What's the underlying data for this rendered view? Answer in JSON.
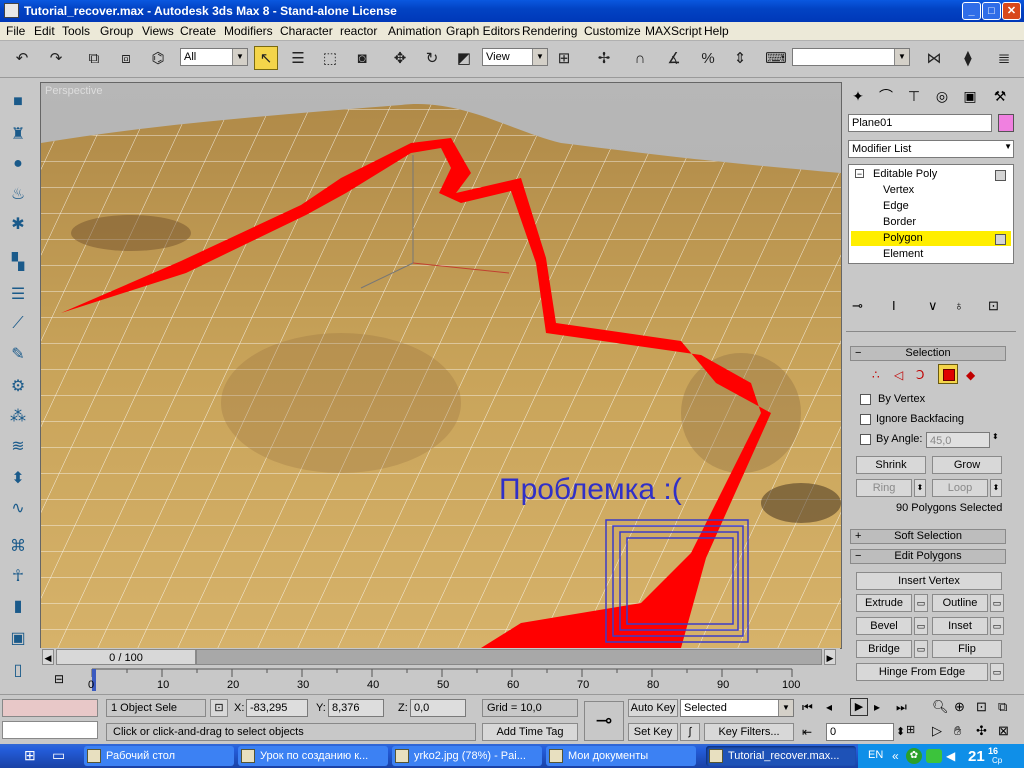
{
  "window": {
    "title": "Tutorial_recover.max - Autodesk 3ds Max 8 - Stand-alone License",
    "minimize_glyph": "_",
    "maximize_glyph": "□",
    "close_glyph": "✕"
  },
  "menu": [
    "File",
    "Edit",
    "Tools",
    "Group",
    "Views",
    "Create",
    "Modifiers",
    "Character",
    "reactor",
    "Animation",
    "Graph Editors",
    "Rendering",
    "Customize",
    "MAXScript",
    "Help"
  ],
  "toolbar": {
    "selection_filter": "All",
    "ref_coord": "View",
    "named_selection": ""
  },
  "viewport": {
    "label": "Perspective",
    "overlay_text": "Проблемка :("
  },
  "command_panel": {
    "object_name": "Plane01",
    "object_color": "#f080e0",
    "modifier_list": "Modifier List",
    "stack": {
      "base": "Editable Poly",
      "subs": [
        "Vertex",
        "Edge",
        "Border",
        "Polygon",
        "Element"
      ],
      "selected": "Polygon"
    },
    "selection": {
      "header": "Selection",
      "by_vertex": "By Vertex",
      "ignore_backfacing": "Ignore Backfacing",
      "by_angle": "By Angle:",
      "angle_value": "45,0",
      "shrink": "Shrink",
      "grow": "Grow",
      "ring": "Ring",
      "loop": "Loop",
      "status": "90 Polygons Selected"
    },
    "soft_selection": "Soft Selection",
    "edit_polygons": {
      "header": "Edit Polygons",
      "insert_vertex": "Insert Vertex",
      "extrude": "Extrude",
      "outline": "Outline",
      "bevel": "Bevel",
      "inset": "Inset",
      "bridge": "Bridge",
      "flip": "Flip",
      "hinge": "Hinge From Edge"
    }
  },
  "timeline": {
    "slider_text": "0 / 100",
    "ticks": [
      "0",
      "10",
      "20",
      "30",
      "40",
      "50",
      "60",
      "70",
      "80",
      "90",
      "100"
    ]
  },
  "status": {
    "selected": "1 Object Sele",
    "x_label": "X:",
    "x": "-83,295",
    "y_label": "Y:",
    "y": "8,376",
    "z_label": "Z:",
    "z": "0,0",
    "grid": "Grid = 10,0",
    "prompt": "Click or click-and-drag to select objects",
    "add_time_tag": "Add Time Tag",
    "auto_key": "Auto Key",
    "set_key": "Set Key",
    "key_mode": "Selected",
    "key_filters": "Key Filters...",
    "frame": "0"
  },
  "taskbar": {
    "items": [
      {
        "label": "Рабочий стол",
        "active": false
      },
      {
        "label": "Урок по созданию к...",
        "active": false
      },
      {
        "label": "yrko2.jpg (78%) - Pai...",
        "active": false
      },
      {
        "label": "Мои документы",
        "active": false
      },
      {
        "label": "Tutorial_recover.max...",
        "active": true
      }
    ],
    "lang": "EN",
    "clock": "21",
    "clock_min": "16",
    "clock_day": "Ср"
  }
}
